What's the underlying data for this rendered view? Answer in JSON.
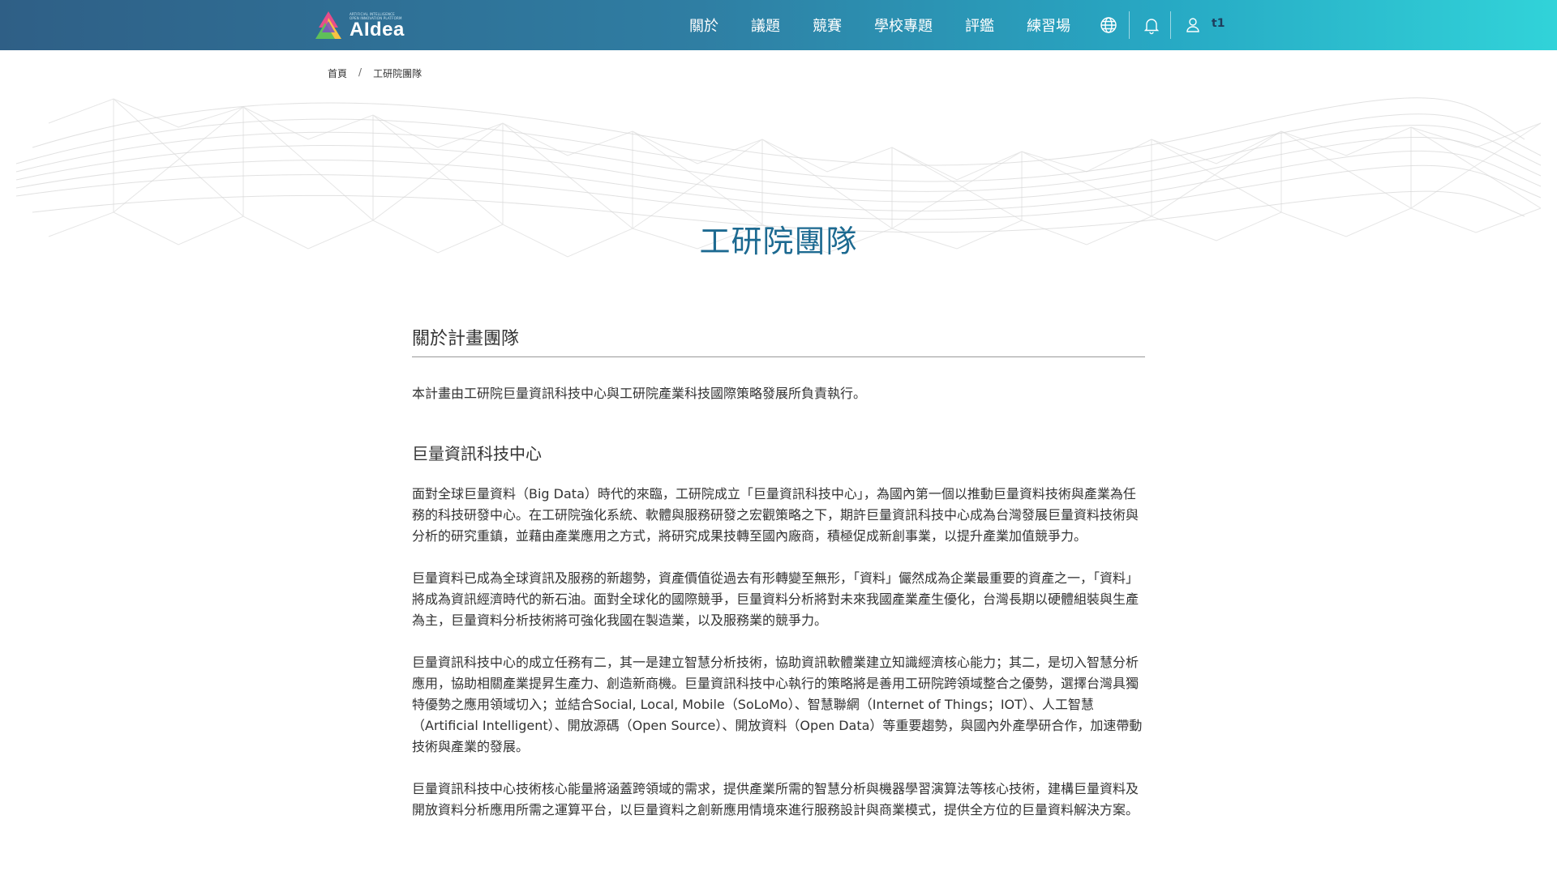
{
  "header": {
    "logo_small_lines": [
      "ARTIFICIAL INTELLIGENCE",
      "OPEN INNOVATION PLATFORM"
    ],
    "logo_name": "AIdea",
    "nav_items": [
      "關於",
      "議題",
      "競賽",
      "學校專題",
      "評鑑",
      "練習場"
    ],
    "icons": [
      "globe-icon",
      "bell-icon",
      "user-icon"
    ],
    "user_name": "t1"
  },
  "breadcrumb": {
    "home": "首頁",
    "separator": "/",
    "current": "工研院團隊"
  },
  "hero": {
    "title": "工研院團隊"
  },
  "content": {
    "section_title": "關於計畫團隊",
    "intro": "本計畫由工研院巨量資訊科技中心與工研院產業科技國際策略發展所負責執行。",
    "subsection_title": "巨量資訊科技中心",
    "paragraphs": [
      "面對全球巨量資料（Big Data）時代的來臨，工研院成立「巨量資訊科技中心」，為國內第一個以推動巨量資料技術與產業為任務的科技研發中心。在工研院強化系統、軟體與服務研發之宏觀策略之下，期許巨量資訊科技中心成為台灣發展巨量資料技術與分析的研究重鎮，並藉由產業應用之方式，將研究成果技轉至國內廠商，積極促成新創事業，以提升產業加值競爭力。",
      "巨量資料已成為全球資訊及服務的新趨勢，資產價值從過去有形轉變至無形，「資料」儼然成為企業最重要的資產之一，「資料」將成為資訊經濟時代的新石油。面對全球化的國際競爭，巨量資料分析將對未來我國產業產生優化，台灣長期以硬體組裝與生產為主，巨量資料分析技術將可強化我國在製造業，以及服務業的競爭力。",
      "巨量資訊科技中心的成立任務有二，其一是建立智慧分析技術，協助資訊軟體業建立知識經濟核心能力；其二，是切入智慧分析應用，協助相關產業提昇生產力、創造新商機。巨量資訊科技中心執行的策略將是善用工研院跨領域整合之優勢，選擇台灣具獨特優勢之應用領域切入；並結合Social, Local, Mobile（SoLoMo）、智慧聯網（Internet of Things；IOT）、人工智慧（Artificial Intelligent）、開放源碼（Open Source）、開放資料（Open Data）等重要趨勢，與國內外產學研合作，加速帶動技術與產業的發展。",
      "巨量資訊科技中心技術核心能量將涵蓋跨領域的需求，提供產業所需的智慧分析與機器學習演算法等核心技術，建構巨量資料及開放資料分析應用所需之運算平台，以巨量資料之創新應用情境來進行服務設計與商業模式，提供全方位的巨量資料解決方案。"
    ]
  },
  "colors": {
    "nav_gradient_start": "#2f5f86",
    "nav_gradient_end": "#31d3d9",
    "hero_title": "#1d6a91",
    "user_label": "#1e3d5c"
  }
}
